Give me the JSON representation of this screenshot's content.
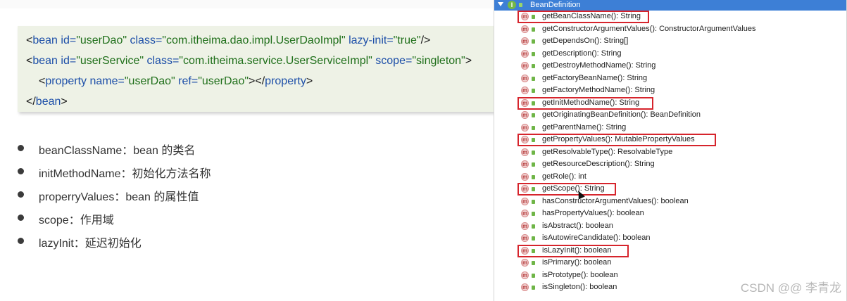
{
  "code": {
    "line1": {
      "open": "<",
      "tag": "bean",
      "a1": "id=",
      "v1": "\"userDao\"",
      "a2": "class=",
      "v2": "\"com.itheima.dao.impl.UserDaoImpl\"",
      "a3": "lazy-init=",
      "v3": "\"true\"",
      "close": "/>"
    },
    "line2": {
      "open": "<",
      "tag": "bean",
      "a1": "id=",
      "v1": "\"userService\"",
      "a2": "class=",
      "v2": "\"com.itheima.service.UserServiceImpl\"",
      "a3": "scope=",
      "v3": "\"singleton\"",
      "close": ">"
    },
    "line3": {
      "open": "<",
      "tag": "property",
      "a1": "name=",
      "v1": "\"userDao\"",
      "a2": "ref=",
      "v2": "\"userDao\"",
      "mid": "></",
      "tag2": "property",
      "close": ">"
    },
    "line4": {
      "open": "</",
      "tag": "bean",
      "close": ">"
    }
  },
  "bullets": [
    "beanClassName：bean 的类名",
    "initMethodName：初始化方法名称",
    "properryValues：bean 的属性值",
    "scope：作用域",
    "lazyInit：延迟初始化"
  ],
  "panel": {
    "header_title": "BeanDefinition",
    "methods": [
      "getBeanClassName(): String",
      "getConstructorArgumentValues(): ConstructorArgumentValues",
      "getDependsOn(): String[]",
      "getDescription(): String",
      "getDestroyMethodName(): String",
      "getFactoryBeanName(): String",
      "getFactoryMethodName(): String",
      "getInitMethodName(): String",
      "getOriginatingBeanDefinition(): BeanDefinition",
      "getParentName(): String",
      "getPropertyValues(): MutablePropertyValues",
      "getResolvableType(): ResolvableType",
      "getResourceDescription(): String",
      "getRole(): int",
      "getScope(): String",
      "hasConstructorArgumentValues(): boolean",
      "hasPropertyValues(): boolean",
      "isAbstract(): boolean",
      "isAutowireCandidate(): boolean",
      "isLazyInit(): boolean",
      "isPrimary(): boolean",
      "isPrototype(): boolean",
      "isSingleton(): boolean"
    ],
    "highlighted": [
      "getBeanClassName(): String",
      "getInitMethodName(): String",
      "getPropertyValues(): MutablePropertyValues",
      "getScope(): String",
      "isLazyInit(): boolean"
    ],
    "method_badge": "m",
    "interface_badge": "I"
  },
  "watermark": "CSDN @@ 李青龙",
  "colors": {
    "header": "#3d7fd6",
    "highlight": "#d6242c",
    "code_bg": "#eef2e6",
    "code_tag": "#1d4fa8",
    "code_value": "#1f6f1a"
  }
}
